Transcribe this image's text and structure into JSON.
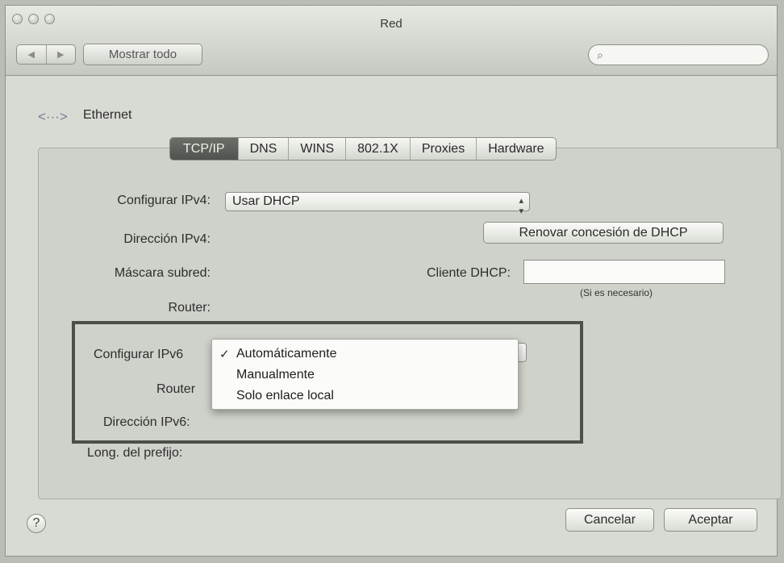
{
  "window": {
    "title": "Red"
  },
  "toolbar": {
    "back": "◀",
    "forward": "▶",
    "show_all": "Mostrar todo",
    "search_placeholder": ""
  },
  "service": {
    "icon": "network-arrows-icon",
    "name": "Ethernet"
  },
  "tabs": [
    "TCP/IP",
    "DNS",
    "WINS",
    "802.1X",
    "Proxies",
    "Hardware"
  ],
  "ipv4": {
    "configure_label": "Configurar IPv4:",
    "configure_value": "Usar DHCP",
    "address_label": "Dirección IPv4:",
    "subnet_label": "Máscara subred:",
    "router_label": "Router:",
    "renew_button": "Renovar concesión de DHCP",
    "client_label": "Cliente DHCP:",
    "client_value": "",
    "client_hint": "(Si es necesario)"
  },
  "ipv6": {
    "configure_label": "Configurar IPv6",
    "router_label": "Router",
    "address_label": "Dirección IPv6:",
    "prefix_label": "Long. del prefijo:",
    "menu": {
      "checkmark": "✓",
      "selected_index": 0,
      "options": [
        "Automáticamente",
        "Manualmente",
        "Solo enlace local"
      ]
    }
  },
  "footer": {
    "help": "?",
    "cancel": "Cancelar",
    "ok": "Aceptar"
  }
}
